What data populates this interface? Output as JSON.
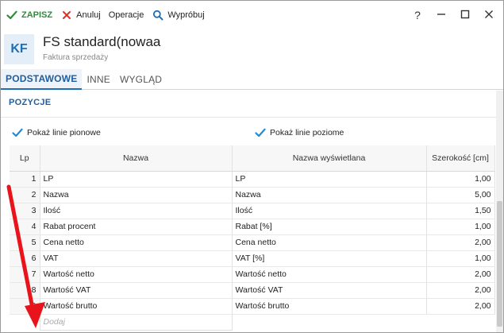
{
  "toolbar": {
    "save_label": "ZAPISZ",
    "cancel_label": "Anuluj",
    "operations_label": "Operacje",
    "try_label": "Wypróbuj"
  },
  "window_controls": {
    "help": "?"
  },
  "header": {
    "avatar_text": "KF",
    "title": "FS standard(nowaa",
    "subtitle": "Faktura sprzedaży"
  },
  "tabs": [
    {
      "label": "PODSTAWOWE",
      "active": true
    },
    {
      "label": "INNE",
      "active": false
    },
    {
      "label": "WYGLĄD",
      "active": false
    }
  ],
  "section": {
    "title": "POZYCJE",
    "vertical_lines_label": "Pokaż linie pionowe",
    "vertical_lines_checked": true,
    "horizontal_lines_label": "Pokaż linie poziome",
    "horizontal_lines_checked": true
  },
  "table": {
    "columns": [
      "Lp",
      "Nazwa",
      "Nazwa wyświetlana",
      "Szerokość [cm]"
    ],
    "rows": [
      {
        "lp": "1",
        "name": "LP",
        "display": "LP",
        "width": "1,00"
      },
      {
        "lp": "2",
        "name": "Nazwa",
        "display": "Nazwa",
        "width": "5,00"
      },
      {
        "lp": "3",
        "name": "Ilość",
        "display": "Ilość",
        "width": "1,50"
      },
      {
        "lp": "4",
        "name": "Rabat procent",
        "display": "Rabat [%]",
        "width": "1,00"
      },
      {
        "lp": "5",
        "name": "Cena netto",
        "display": "Cena netto",
        "width": "2,00"
      },
      {
        "lp": "6",
        "name": "VAT",
        "display": "VAT [%]",
        "width": "1,00"
      },
      {
        "lp": "7",
        "name": "Wartość netto",
        "display": "Wartość netto",
        "width": "2,00"
      },
      {
        "lp": "8",
        "name": "Wartość VAT",
        "display": "Wartość VAT",
        "width": "2,00"
      },
      {
        "lp": "9",
        "name": "Wartość brutto",
        "display": "Wartość brutto",
        "width": "2,00"
      }
    ],
    "add_placeholder": "Dodaj"
  },
  "colors": {
    "accent": "#1f6fb5",
    "save_green": "#2e8b3a",
    "cancel_red": "#d9342b",
    "annotation_red": "#e8131b"
  }
}
